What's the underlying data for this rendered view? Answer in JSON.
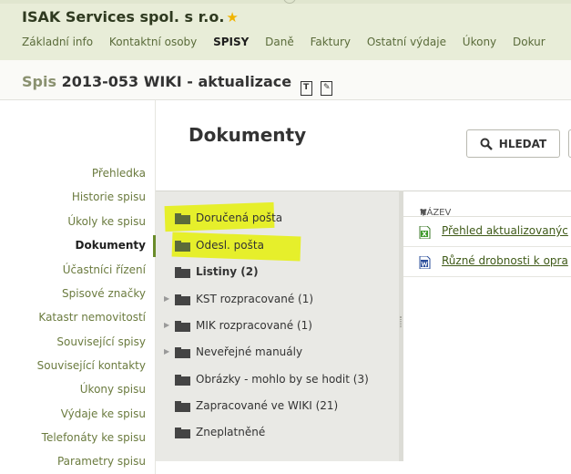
{
  "header": {
    "company": "ISAK Services spol. s r.o.",
    "star_icon": "star-icon",
    "tabs": [
      "Základní info",
      "Kontaktní osoby",
      "SPISY",
      "Daně",
      "Faktury",
      "Ostatní výdaje",
      "Úkony",
      "Dokur"
    ],
    "active_tab": "SPISY"
  },
  "spis": {
    "prefix": "Spis",
    "title": "2013-053 WIKI - aktualizace",
    "icon1_letter": "T",
    "icon2_letter": "✎"
  },
  "nav": {
    "items": [
      "Přehledka",
      "Historie spisu",
      "Úkoly ke spisu",
      "Dokumenty",
      "Účastníci řízení",
      "Spisové značky",
      "Katastr nemovitostí",
      "Související spisy",
      "Související kontakty",
      "Úkony spisu",
      "Výdaje ke spisu",
      "Telefonáty ke spisu",
      "Parametry spisu"
    ],
    "active": "Dokumenty"
  },
  "main": {
    "title": "Dokumenty",
    "search_label": "HLEDAT"
  },
  "tree": {
    "folders": [
      {
        "label": "Doručená pošta",
        "expandable": false,
        "bold": false,
        "highlighted": true
      },
      {
        "label": "Odesl. pošta",
        "expandable": false,
        "bold": false,
        "highlighted": true
      },
      {
        "label": "Listiny (2)",
        "expandable": false,
        "bold": true,
        "highlighted": false
      },
      {
        "label": "KST rozpracované (1)",
        "expandable": true,
        "bold": false,
        "highlighted": false
      },
      {
        "label": "MIK rozpracované (1)",
        "expandable": true,
        "bold": false,
        "highlighted": false
      },
      {
        "label": "Neveřejné manuály",
        "expandable": true,
        "bold": false,
        "highlighted": false
      },
      {
        "label": "Obrázky - mohlo by se hodit (3)",
        "expandable": false,
        "bold": false,
        "highlighted": false
      },
      {
        "label": "Zapracované ve WIKI (21)",
        "expandable": false,
        "bold": false,
        "highlighted": false
      },
      {
        "label": "Zneplatněné",
        "expandable": false,
        "bold": false,
        "highlighted": false
      }
    ]
  },
  "list": {
    "column_header": "NÁZEV",
    "sort_icon": "sort-down-icon",
    "rows": [
      {
        "label": "Přehled aktualizovanýc",
        "icon": "excel-file-icon"
      },
      {
        "label": "Různé drobnosti k opra",
        "icon": "word-file-icon"
      }
    ]
  },
  "colors": {
    "accent": "#6a8c2a",
    "highlight": "#e6ef21",
    "folder": "#5b6b3a"
  }
}
